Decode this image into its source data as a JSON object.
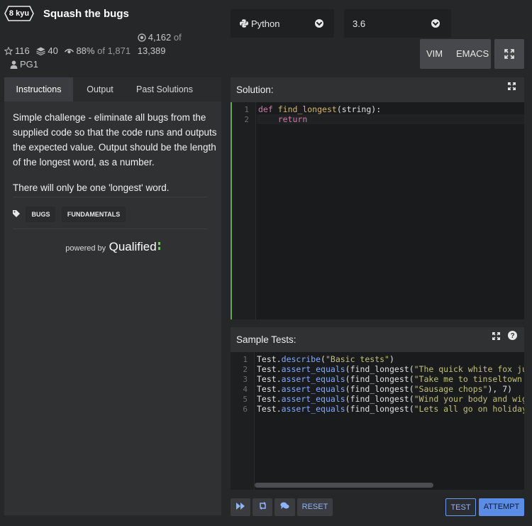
{
  "kata": {
    "rank": "8 kyu",
    "title": "Squash the bugs",
    "stats": {
      "stars": "116",
      "collections": "40",
      "satisfaction": "88%",
      "satisfaction_of": "of 1,871",
      "completed": "4,162",
      "completed_of": "of",
      "total": "13,389",
      "author": "PG1"
    }
  },
  "language": {
    "selected": "Python",
    "icon": "python-icon"
  },
  "version": {
    "selected": "3.6"
  },
  "editor_modes": {
    "vim": "VIM",
    "emacs": "EMACS"
  },
  "tabs": [
    {
      "label": "Instructions",
      "active": true
    },
    {
      "label": "Output",
      "active": false
    },
    {
      "label": "Past Solutions",
      "active": false
    }
  ],
  "description": {
    "paragraph1": "Simple challenge - eliminate all bugs from the supplied code so that the code runs and outputs the expected value. Output should be the length of the longest word, as a number.",
    "paragraph2": "There will only be one 'longest' word."
  },
  "tags": [
    "BUGS",
    "FUNDAMENTALS"
  ],
  "powered_by": {
    "prefix": "powered by",
    "brand": "Qualified"
  },
  "solution": {
    "title": "Solution:",
    "line_numbers": [
      "1",
      "2"
    ],
    "line1": {
      "kw": "def",
      "fn": "find_longest",
      "rest": "(string):"
    },
    "line2": {
      "indent": "    ",
      "kw": "return"
    }
  },
  "sample_tests": {
    "title": "Sample Tests:",
    "line_numbers": [
      "1",
      "2",
      "3",
      "4",
      "5",
      "6"
    ],
    "obj": "Test",
    "dot": ".",
    "describe": "describe",
    "describe_arg": "\"Basic tests\"",
    "assert": "assert_equals",
    "fn": "find_longest",
    "lines": [
      {
        "str": "\"The quick white fox jumped",
        "tail": ""
      },
      {
        "str": "\"Take me to tinseltown with",
        "tail": ""
      },
      {
        "str": "\"Sausage chops\"",
        "tail": "), 7)"
      },
      {
        "str": "\"Wind your body and wiggle",
        "tail": ""
      },
      {
        "str": "\"Lets all go on holiday\"",
        "tail": "),"
      }
    ]
  },
  "buttons": {
    "reset": "RESET",
    "test": "TEST",
    "attempt": "ATTEMPT"
  },
  "colors": {
    "background": "#262729",
    "panel": "#303133",
    "accent_blue": "#5b8de6",
    "qualified_green": "#6fcf5e"
  }
}
